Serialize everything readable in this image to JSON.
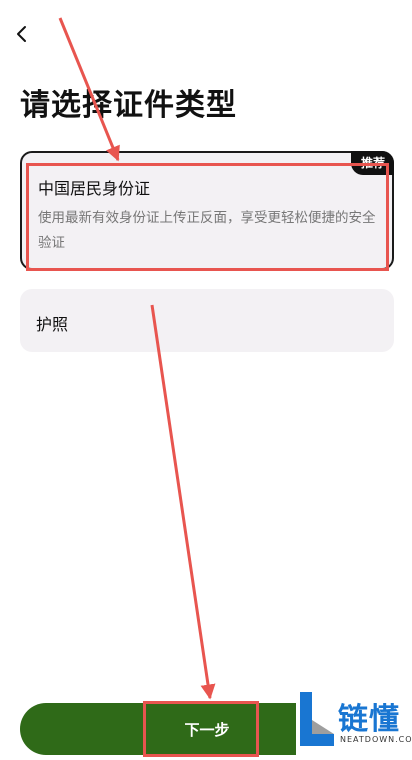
{
  "header": {
    "back_icon": "chevron-left-icon"
  },
  "page_title": "请选择证件类型",
  "options": [
    {
      "name": "中国居民身份证",
      "description": "使用最新有效身份证上传正反面，享受更轻松便捷的安全验证",
      "badge": "推荐",
      "selected": true
    },
    {
      "name": "护照",
      "selected": false
    }
  ],
  "next_button": {
    "label": "下一步"
  },
  "watermark": {
    "brand": "链懂",
    "domain": "NEATDOWN.COM"
  },
  "colors": {
    "accent_green": "#2f6a18",
    "annotation_red": "#e8554f",
    "card_bg": "#f3f1f4",
    "badge_bg": "#111111",
    "watermark_blue": "#1976d2"
  }
}
